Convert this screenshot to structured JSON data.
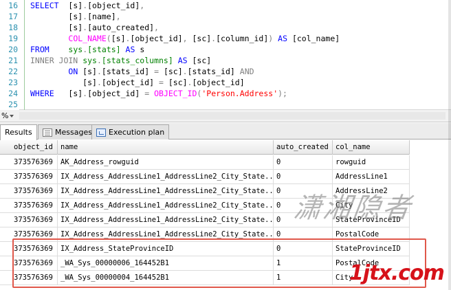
{
  "editor": {
    "lines": [
      {
        "num": "16",
        "tokens": [
          {
            "c": "kw",
            "t": "SELECT"
          },
          {
            "c": "id",
            "t": "  "
          },
          {
            "c": "id",
            "t": "[s]"
          },
          {
            "c": "op",
            "t": "."
          },
          {
            "c": "id",
            "t": "[object_id]"
          },
          {
            "c": "op",
            "t": ","
          }
        ]
      },
      {
        "num": "17",
        "tokens": [
          {
            "c": "id",
            "t": "        "
          },
          {
            "c": "id",
            "t": "[s]"
          },
          {
            "c": "op",
            "t": "."
          },
          {
            "c": "id",
            "t": "[name]"
          },
          {
            "c": "op",
            "t": ","
          }
        ]
      },
      {
        "num": "18",
        "tokens": [
          {
            "c": "id",
            "t": "        "
          },
          {
            "c": "id",
            "t": "[s]"
          },
          {
            "c": "op",
            "t": "."
          },
          {
            "c": "id",
            "t": "[auto_created]"
          },
          {
            "c": "op",
            "t": ","
          }
        ]
      },
      {
        "num": "19",
        "tokens": [
          {
            "c": "id",
            "t": "        "
          },
          {
            "c": "fn",
            "t": "COL_NAME"
          },
          {
            "c": "op",
            "t": "("
          },
          {
            "c": "id",
            "t": "[s]"
          },
          {
            "c": "op",
            "t": "."
          },
          {
            "c": "id",
            "t": "[object_id]"
          },
          {
            "c": "op",
            "t": ", "
          },
          {
            "c": "id",
            "t": "[sc]"
          },
          {
            "c": "op",
            "t": "."
          },
          {
            "c": "id",
            "t": "[column_id]"
          },
          {
            "c": "op",
            "t": ")"
          },
          {
            "c": "id",
            "t": " "
          },
          {
            "c": "kw",
            "t": "AS"
          },
          {
            "c": "id",
            "t": " [col_name]"
          }
        ]
      },
      {
        "num": "20",
        "tokens": [
          {
            "c": "kw",
            "t": "FROM"
          },
          {
            "c": "id",
            "t": "    "
          },
          {
            "c": "sys",
            "t": "sys"
          },
          {
            "c": "op",
            "t": "."
          },
          {
            "c": "sys",
            "t": "[stats]"
          },
          {
            "c": "id",
            "t": " "
          },
          {
            "c": "kw",
            "t": "AS"
          },
          {
            "c": "id",
            "t": " s"
          }
        ]
      },
      {
        "num": "21",
        "tokens": [
          {
            "c": "op",
            "t": "INNER JOIN"
          },
          {
            "c": "id",
            "t": " "
          },
          {
            "c": "sys",
            "t": "sys"
          },
          {
            "c": "op",
            "t": "."
          },
          {
            "c": "sys",
            "t": "[stats_columns]"
          },
          {
            "c": "id",
            "t": " "
          },
          {
            "c": "kw",
            "t": "AS"
          },
          {
            "c": "id",
            "t": " [sc]"
          }
        ]
      },
      {
        "num": "22",
        "tokens": [
          {
            "c": "id",
            "t": "        "
          },
          {
            "c": "kw",
            "t": "ON"
          },
          {
            "c": "id",
            "t": " [s]"
          },
          {
            "c": "op",
            "t": "."
          },
          {
            "c": "id",
            "t": "[stats_id]"
          },
          {
            "c": "id",
            "t": " "
          },
          {
            "c": "op",
            "t": "="
          },
          {
            "c": "id",
            "t": " [sc]"
          },
          {
            "c": "op",
            "t": "."
          },
          {
            "c": "id",
            "t": "[stats_id]"
          },
          {
            "c": "id",
            "t": " "
          },
          {
            "c": "op",
            "t": "AND"
          }
        ]
      },
      {
        "num": "23",
        "tokens": [
          {
            "c": "id",
            "t": "           [s]"
          },
          {
            "c": "op",
            "t": "."
          },
          {
            "c": "id",
            "t": "[object_id]"
          },
          {
            "c": "id",
            "t": " "
          },
          {
            "c": "op",
            "t": "="
          },
          {
            "c": "id",
            "t": " [sc]"
          },
          {
            "c": "op",
            "t": "."
          },
          {
            "c": "id",
            "t": "[object_id]"
          }
        ]
      },
      {
        "num": "24",
        "tokens": [
          {
            "c": "kw",
            "t": "WHERE"
          },
          {
            "c": "id",
            "t": "   [s]"
          },
          {
            "c": "op",
            "t": "."
          },
          {
            "c": "id",
            "t": "[object_id]"
          },
          {
            "c": "id",
            "t": " "
          },
          {
            "c": "op",
            "t": "="
          },
          {
            "c": "id",
            "t": " "
          },
          {
            "c": "fn",
            "t": "OBJECT_ID"
          },
          {
            "c": "op",
            "t": "("
          },
          {
            "c": "str",
            "t": "'Person.Address'"
          },
          {
            "c": "op",
            "t": ");"
          }
        ]
      },
      {
        "num": "25",
        "tokens": []
      }
    ]
  },
  "zoom": {
    "label": "%"
  },
  "tabs": [
    {
      "label": "Results",
      "icon": "grid-icon",
      "active": true
    },
    {
      "label": "Messages",
      "icon": "messages-icon",
      "active": false
    },
    {
      "label": "Execution plan",
      "icon": "execution-plan-icon",
      "active": false
    }
  ],
  "grid": {
    "columns": [
      "object_id",
      "name",
      "auto_created",
      "col_name"
    ],
    "rows": [
      [
        "373576369",
        "AK_Address_rowguid",
        "0",
        "rowguid"
      ],
      [
        "373576369",
        "IX_Address_AddressLine1_AddressLine2_City_State...",
        "0",
        "AddressLine1"
      ],
      [
        "373576369",
        "IX_Address_AddressLine1_AddressLine2_City_State...",
        "0",
        "AddressLine2"
      ],
      [
        "373576369",
        "IX_Address_AddressLine1_AddressLine2_City_State...",
        "0",
        "City"
      ],
      [
        "373576369",
        "IX_Address_AddressLine1_AddressLine2_City_State...",
        "0",
        "StateProvinceID"
      ],
      [
        "373576369",
        "IX_Address_AddressLine1_AddressLine2_City_State...",
        "0",
        "PostalCode"
      ],
      [
        "373576369",
        "IX_Address_StateProvinceID",
        "0",
        "StateProvinceID"
      ],
      [
        "373576369",
        "_WA_Sys_00000006_164452B1",
        "1",
        "PostalCode"
      ],
      [
        "373576369",
        "_WA_Sys_00000004_164452B1",
        "1",
        "City"
      ]
    ]
  },
  "watermark": {
    "cn": "潇湘隐者",
    "url": "1jtx.com"
  },
  "colors": {
    "highlight": "#e0574a",
    "keyword": "#0000ff",
    "function": "#ff00ff",
    "system": "#008000",
    "string": "#ff0000",
    "line_number": "#2b91af"
  }
}
